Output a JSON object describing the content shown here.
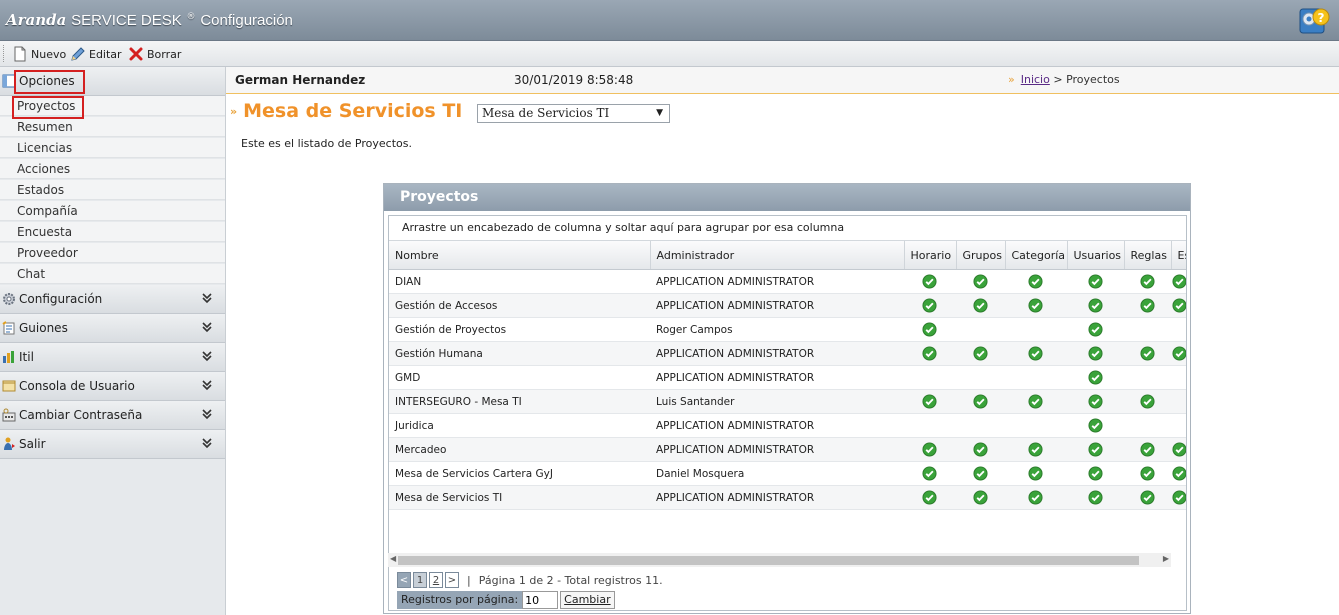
{
  "app": {
    "brand": "Aranda",
    "product": "SERVICE DESK",
    "reg": "®",
    "section": "Configuración"
  },
  "toolbar": {
    "new_label": "Nuevo",
    "edit_label": "Editar",
    "delete_label": "Borrar"
  },
  "sidebar": {
    "opciones": "Opciones",
    "items": [
      "Proyectos",
      "Resumen",
      "Licencias",
      "Acciones",
      "Estados",
      "Compañía",
      "Encuesta",
      "Proveedor",
      "Chat"
    ],
    "sections": [
      "Configuración",
      "Guiones",
      "Itil",
      "Consola de Usuario",
      "Cambiar Contraseña",
      "Salir"
    ]
  },
  "userbar": {
    "user": "German Hernandez",
    "datetime": "30/01/2019 8:58:48",
    "breadcrumb_home": "Inicio",
    "breadcrumb_sep": ">",
    "breadcrumb_current": "Proyectos"
  },
  "page": {
    "title": "Mesa de Servicios TI",
    "select_value": "Mesa de Servicios TI",
    "intro": "Este es el listado de Proyectos."
  },
  "grid": {
    "title": "Proyectos",
    "group_hint": "Arrastre un encabezado de columna y soltar aquí para agrupar por esa columna",
    "columns": [
      "Nombre",
      "Administrador",
      "Horario",
      "Grupos",
      "Categoría",
      "Usuarios",
      "Reglas",
      "Es"
    ],
    "rows": [
      {
        "name": "DIAN",
        "admin": "APPLICATION ADMINISTRATOR",
        "checks": [
          true,
          true,
          true,
          true,
          true,
          true
        ]
      },
      {
        "name": "Gestión de Accesos",
        "admin": "APPLICATION ADMINISTRATOR",
        "checks": [
          true,
          true,
          true,
          true,
          true,
          true
        ]
      },
      {
        "name": "Gestión de Proyectos",
        "admin": "Roger Campos",
        "checks": [
          true,
          false,
          false,
          true,
          false,
          false
        ]
      },
      {
        "name": "Gestión Humana",
        "admin": "APPLICATION ADMINISTRATOR",
        "checks": [
          true,
          true,
          true,
          true,
          true,
          true
        ]
      },
      {
        "name": "GMD",
        "admin": "APPLICATION ADMINISTRATOR",
        "checks": [
          false,
          false,
          false,
          true,
          false,
          false
        ]
      },
      {
        "name": "INTERSEGURO - Mesa TI",
        "admin": "Luis Santander",
        "checks": [
          true,
          true,
          true,
          true,
          true,
          false
        ]
      },
      {
        "name": "Juridica",
        "admin": "APPLICATION ADMINISTRATOR",
        "checks": [
          false,
          false,
          false,
          true,
          false,
          false
        ]
      },
      {
        "name": "Mercadeo",
        "admin": "APPLICATION ADMINISTRATOR",
        "checks": [
          true,
          true,
          true,
          true,
          true,
          true
        ]
      },
      {
        "name": "Mesa de Servicios Cartera GyJ",
        "admin": "Daniel Mosquera",
        "checks": [
          true,
          true,
          true,
          true,
          true,
          true
        ]
      },
      {
        "name": "Mesa de Servicios TI",
        "admin": "APPLICATION ADMINISTRATOR",
        "checks": [
          true,
          true,
          true,
          true,
          true,
          true
        ]
      }
    ],
    "pager": {
      "prev": "<",
      "pages": [
        "1",
        "2"
      ],
      "next": ">",
      "sep": "|",
      "info": "Página 1 de 2 - Total registros 11."
    },
    "per_page_label": "Registros por página:",
    "per_page_value": "10",
    "change_label": "Cambiar"
  },
  "colors": {
    "accent": "#f0922a",
    "check": "#3aa33a",
    "highlight": "#d42020"
  }
}
